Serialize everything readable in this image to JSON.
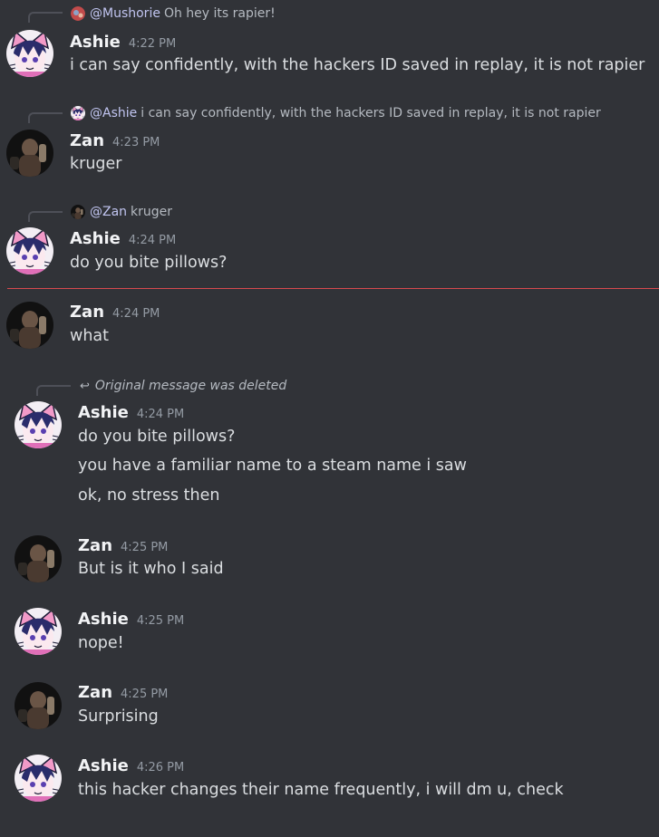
{
  "messages": [
    {
      "reply": {
        "mention": "@Mushorie",
        "text": "Oh hey its rapier!"
      },
      "author": "Ashie",
      "time": "4:22 PM",
      "lines": [
        "i can say confidently, with the hackers ID saved in replay, it is not rapier"
      ]
    },
    {
      "reply": {
        "mention": "@Ashie",
        "text": "i can say confidently, with the hackers ID saved in replay, it is not rapier"
      },
      "author": "Zan",
      "time": "4:23 PM",
      "lines": [
        "kruger"
      ]
    },
    {
      "reply": {
        "mention": "@Zan",
        "text": "kruger"
      },
      "author": "Ashie",
      "time": "4:24 PM",
      "lines": [
        "do you bite pillows?"
      ]
    },
    {
      "author": "Zan",
      "time": "4:24 PM",
      "lines": [
        "what"
      ]
    },
    {
      "reply": {
        "deleted_text": "Original message was deleted"
      },
      "author": "Ashie",
      "time": "4:24 PM",
      "lines": [
        "do you bite pillows?",
        "you have a familiar name to a steam name i saw",
        "ok, no stress then"
      ]
    },
    {
      "author": "Zan",
      "time": "4:25 PM",
      "lines": [
        "But is it who I said"
      ]
    },
    {
      "author": "Ashie",
      "time": "4:25 PM",
      "lines": [
        "nope!"
      ]
    },
    {
      "author": "Zan",
      "time": "4:25 PM",
      "lines": [
        "Surprising"
      ]
    },
    {
      "author": "Ashie",
      "time": "4:26 PM",
      "lines": [
        "this hacker changes their name frequently, i will dm u, check"
      ]
    }
  ],
  "colors": {
    "background": "#313338",
    "new_messages_divider": "#d84a4f",
    "mention": "#c9cdfb"
  }
}
